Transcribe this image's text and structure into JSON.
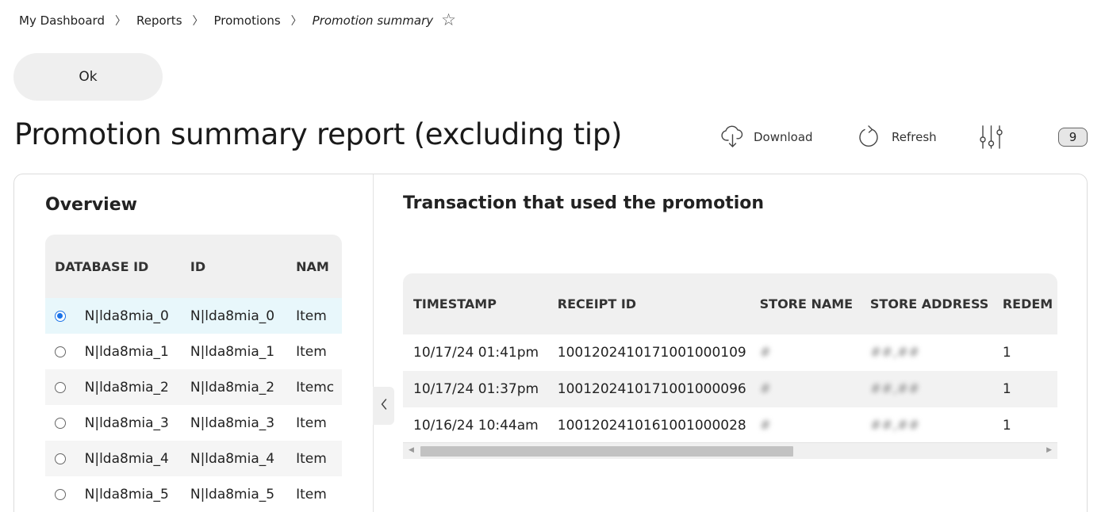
{
  "breadcrumb": {
    "items": [
      "My Dashboard",
      "Reports",
      "Promotions"
    ],
    "current": "Promotion summary",
    "separator": "〉"
  },
  "ok_button": {
    "label": "Ok"
  },
  "page_title": "Promotion summary report (excluding tip)",
  "toolbar": {
    "download_label": "Download",
    "refresh_label": "Refresh",
    "filter_count": "9"
  },
  "overview": {
    "title": "Overview",
    "columns": [
      "DATABASE ID",
      "ID",
      "NAM"
    ],
    "selected_index": 0,
    "rows": [
      {
        "db_id": "N|lda8mia_0",
        "id": "N|lda8mia_0",
        "name": "Item"
      },
      {
        "db_id": "N|lda8mia_1",
        "id": "N|lda8mia_1",
        "name": "Item"
      },
      {
        "db_id": "N|lda8mia_2",
        "id": "N|lda8mia_2",
        "name": "Itemc"
      },
      {
        "db_id": "N|lda8mia_3",
        "id": "N|lda8mia_3",
        "name": "Item"
      },
      {
        "db_id": "N|lda8mia_4",
        "id": "N|lda8mia_4",
        "name": "Item"
      },
      {
        "db_id": "N|lda8mia_5",
        "id": "N|lda8mia_5",
        "name": "Item"
      }
    ]
  },
  "transactions": {
    "title": "Transaction that used the promotion",
    "columns": [
      "TIMESTAMP",
      "RECEIPT ID",
      "STORE NAME",
      "STORE ADDRESS",
      "REDEM"
    ],
    "rows": [
      {
        "timestamp": "10/17/24 01:41pm",
        "receipt_id": "1001202410171001000109",
        "store_name": "#",
        "store_address": "##,##",
        "redeemed": "1"
      },
      {
        "timestamp": "10/17/24 01:37pm",
        "receipt_id": "1001202410171001000096",
        "store_name": "#",
        "store_address": "##,##",
        "redeemed": "1"
      },
      {
        "timestamp": "10/16/24 10:44am",
        "receipt_id": "1001202410161001000028",
        "store_name": "#",
        "store_address": "##,##",
        "redeemed": "1"
      }
    ]
  },
  "colors": {
    "accent": "#1a73e8",
    "selected_row": "#e8f7fb",
    "header_bg": "#f0f0f0"
  }
}
